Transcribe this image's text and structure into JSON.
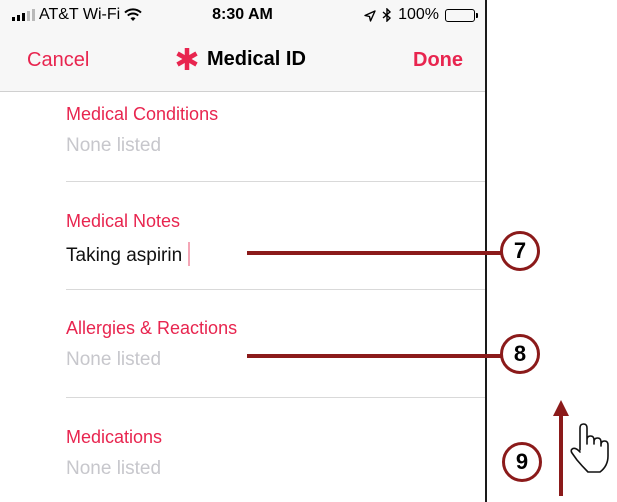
{
  "status_bar": {
    "carrier": "AT&T Wi-Fi",
    "time": "8:30 AM",
    "battery": "100%"
  },
  "nav": {
    "cancel_label": "Cancel",
    "title": "Medical ID",
    "done_label": "Done"
  },
  "sections": [
    {
      "label": "Medical Conditions",
      "value": "None listed"
    },
    {
      "label": "Medical Notes",
      "value": "Taking aspirin"
    },
    {
      "label": "Allergies & Reactions",
      "value": "None listed"
    },
    {
      "label": "Medications",
      "value": "None listed"
    }
  ],
  "callouts": [
    "7",
    "8",
    "9"
  ],
  "colors": {
    "accent": "#e8254f",
    "placeholder": "#c7c7cc",
    "callout": "#8b1a1a"
  }
}
